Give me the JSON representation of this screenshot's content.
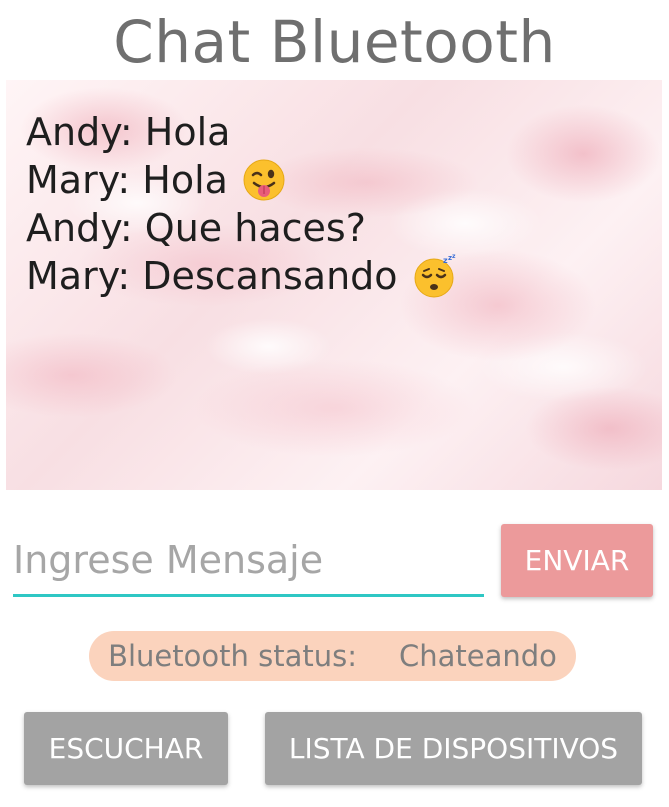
{
  "app": {
    "title": "Chat Bluetooth"
  },
  "chat": {
    "messages": [
      {
        "text": "Andy: Hola",
        "emoji": null
      },
      {
        "text": "Mary: Hola",
        "emoji": "winking-face-with-tongue-icon"
      },
      {
        "text": "Andy: Que haces?",
        "emoji": null
      },
      {
        "text": "Mary: Descansando",
        "emoji": "sleeping-face-icon"
      }
    ]
  },
  "composer": {
    "placeholder": "Ingrese Mensaje",
    "value": "",
    "send_label": "ENVIAR"
  },
  "status": {
    "label": "Bluetooth status:",
    "value": "Chateando"
  },
  "actions": {
    "listen_label": "ESCUCHAR",
    "devices_label": "LISTA DE DISPOSITIVOS"
  },
  "colors": {
    "accent_underline": "#2ec7c4",
    "send_button": "#ec9a9b",
    "status_pill": "#fbd3bd",
    "gray_button": "#a3a3a3",
    "title_text": "#6f6f6f"
  }
}
